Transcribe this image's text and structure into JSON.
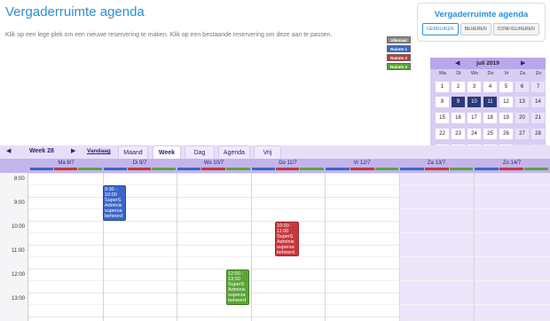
{
  "page": {
    "title": "Vergaderruimte agenda",
    "instructions": "Klik op een lege plek om een nieuwe reservering te maken. Klik op een bestaande reservering om deze aan te passen."
  },
  "panel": {
    "title": "Vergaderruimte agenda",
    "buttons": [
      "GEBRUIKEN",
      "BEHEREN",
      "CONFIGUREREN"
    ]
  },
  "legend": [
    {
      "label": "Allemaal",
      "color": "#8a8a8a"
    },
    {
      "label": "Ruimte 1",
      "color": "#3a66c9"
    },
    {
      "label": "Ruimte 2",
      "color": "#c8373d"
    },
    {
      "label": "Ruimte 3",
      "color": "#5aa537"
    }
  ],
  "mini_calendar": {
    "title": "juli 2019",
    "weekdays": [
      "Ma",
      "Di",
      "Wo",
      "Do",
      "Vr",
      "Za",
      "Zo"
    ],
    "weeks": [
      [
        "1",
        "2",
        "3",
        "4",
        "5",
        "6",
        "7"
      ],
      [
        "8",
        "9",
        "10",
        "11",
        "12",
        "13",
        "14"
      ],
      [
        "15",
        "16",
        "17",
        "18",
        "19",
        "20",
        "21"
      ],
      [
        "22",
        "23",
        "24",
        "25",
        "26",
        "27",
        "28"
      ],
      [
        "29",
        "30",
        "31",
        "1",
        "2",
        "3",
        "4"
      ]
    ]
  },
  "toolbar": {
    "week_label": "Week 28",
    "today_label": "Vandaag",
    "tabs": [
      "Maand",
      "Week",
      "Dag",
      "Agenda",
      "Vrij"
    ],
    "active_tab": "Week"
  },
  "days": [
    "Ma 8/7",
    "Di 9/7",
    "Wo 10/7",
    "Do 11/7",
    "Vr 12/7",
    "Za 13/7",
    "Zo 14/7"
  ],
  "times": [
    "8:00",
    "9:00",
    "10:00",
    "11:00",
    "12:00",
    "13:00"
  ],
  "events": [
    {
      "time": "9:30 - 10:00",
      "text": "SuperS Adminis supersa beheerd",
      "color": "#3a66c9"
    },
    {
      "time": "10:00 - 11:00",
      "text": "SuperS Adminis supersa beheerd",
      "color": "#c8373d"
    },
    {
      "time": "12:00 - 13:30",
      "text": "SuperS Adminis supersa beheerd",
      "color": "#5aa537"
    }
  ]
}
